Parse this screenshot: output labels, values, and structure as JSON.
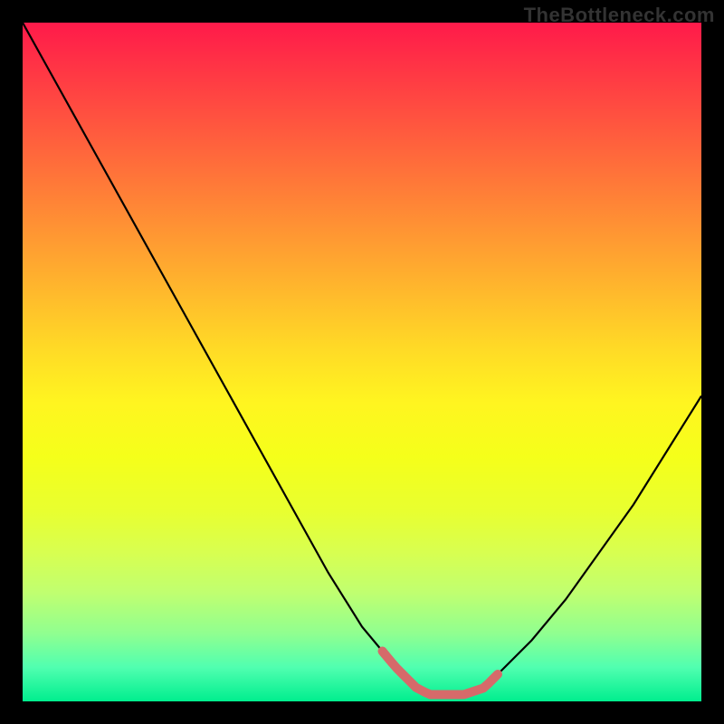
{
  "watermark": "TheBottleneck.com",
  "chart_data": {
    "type": "line",
    "title": "",
    "xlabel": "",
    "ylabel": "",
    "xlim": [
      0,
      100
    ],
    "ylim": [
      0,
      100
    ],
    "x": [
      0,
      5,
      10,
      15,
      20,
      25,
      30,
      35,
      40,
      45,
      50,
      55,
      58,
      60,
      62,
      65,
      68,
      70,
      75,
      80,
      85,
      90,
      95,
      100
    ],
    "values": [
      100,
      91,
      82,
      73,
      64,
      55,
      46,
      37,
      28,
      19,
      11,
      5,
      2,
      1,
      1,
      1,
      2,
      4,
      9,
      15,
      22,
      29,
      37,
      45
    ],
    "highlight_band_x": [
      53,
      70
    ],
    "highlight_band_color": "#d66a6a",
    "gradient_stops": [
      {
        "pct": 0,
        "color": "#ff1a4a"
      },
      {
        "pct": 50,
        "color": "#fff520"
      },
      {
        "pct": 100,
        "color": "#00ee8e"
      }
    ]
  }
}
